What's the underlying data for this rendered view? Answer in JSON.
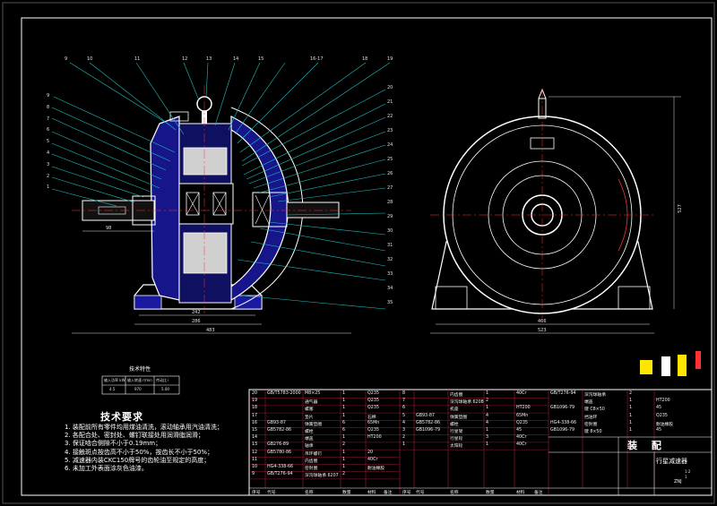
{
  "drawing": {
    "title_block": {
      "assembly_label": "装 配",
      "product_name": "行星减速器",
      "drawing_code": "ZNJ",
      "scale": "1:2",
      "sheet": "1"
    },
    "tech_requirements": {
      "title": "技术要求",
      "items": [
        "1. 装配前所有零件均用煤油清洗，滚动轴承用汽油清洗；",
        "2. 各配合处、密封处、螺钉联接处用润滑脂润滑；",
        "3. 保证啮合侧隙不小于0.19mm；",
        "4. 接触斑点按齿高不小于50%，按齿长不小于50%；",
        "5. 减速器内装CKC150牌号的齿轮油至规定的高度；",
        "6. 未加工外表面涂灰色油漆。"
      ]
    },
    "tech_table_title": "技术特性",
    "tech_table_rows": [
      [
        "输入功率 kW",
        "输入转速 r/min",
        "传动比 i"
      ],
      [
        "4.5",
        "970",
        "5.00"
      ]
    ],
    "balloon_numbers_left": [
      "9",
      "8",
      "7",
      "6",
      "5",
      "4",
      "3",
      "2",
      "1"
    ],
    "balloon_numbers_top": [
      "9",
      "10",
      "11",
      "12",
      "13",
      "14",
      "15",
      "16-17",
      "18",
      "19"
    ],
    "balloon_numbers_right": [
      "20",
      "21",
      "22",
      "23",
      "24",
      "25",
      "26",
      "27",
      "28",
      "29",
      "30",
      "31",
      "32",
      "33",
      "34",
      "35"
    ],
    "dimensions": {
      "left_bottom_a": "242",
      "left_bottom_b": "286",
      "left_bottom_c": "483",
      "left_shaft": "98",
      "right_bottom_a": "466",
      "right_bottom_b": "523",
      "right_height": "527"
    },
    "bom_left": [
      [
        "20",
        "GB/T5783-2000",
        "M8×25",
        "1",
        "Q235"
      ],
      [
        "19",
        "",
        "通气器",
        "1",
        "Q235"
      ],
      [
        "18",
        "",
        "螺塞",
        "1",
        "Q235"
      ],
      [
        "17",
        "",
        "垫片",
        "1",
        "石棉"
      ],
      [
        "16",
        "GB93-87",
        "弹簧垫圈",
        "6",
        "65Mn"
      ],
      [
        "15",
        "GB5782-86",
        "螺栓",
        "6",
        "Q235"
      ],
      [
        "14",
        "",
        "端盖",
        "1",
        "HT200"
      ],
      [
        "13",
        "GB276-89",
        "轴承",
        "2",
        ""
      ],
      [
        "12",
        "GB5780-86",
        "吊环螺钉",
        "1",
        "20"
      ],
      [
        "11",
        "",
        "内齿圈",
        "1",
        "40Cr"
      ],
      [
        "10",
        "HG4-338-66",
        "密封圈",
        "1",
        "耐油橡胶"
      ],
      [
        "9",
        "GB/T276-94",
        "深沟球轴承 6207",
        "2",
        ""
      ]
    ],
    "bom_mid": [
      [
        "8",
        "",
        "内齿圈",
        "1",
        "40Cr"
      ],
      [
        "7",
        "",
        "深沟球轴承 6208",
        "2",
        ""
      ],
      [
        "6",
        "",
        "机座",
        "1",
        "HT200"
      ],
      [
        "5",
        "GB93-87",
        "弹簧垫圈",
        "4",
        "65Mn"
      ],
      [
        "4",
        "GB5782-86",
        "螺栓",
        "4",
        "Q235"
      ],
      [
        "3",
        "GB1096-79",
        "行星架",
        "1",
        "45"
      ],
      [
        "2",
        "",
        "行星轮",
        "3",
        "40Cr"
      ],
      [
        "1",
        "",
        "太阳轮",
        "1",
        "40Cr"
      ]
    ],
    "bom_right": [
      [
        "GB/T276-94",
        "深沟球轴承",
        "2",
        ""
      ],
      [
        "",
        "端盖",
        "1",
        "HT200"
      ],
      [
        "GB1096-79",
        "键 C8×50",
        "1",
        "45"
      ],
      [
        "",
        "挡油环",
        "1",
        "Q235"
      ],
      [
        "HG4-338-66",
        "密封圈",
        "1",
        "耐油橡胶"
      ],
      [
        "GB1096-79",
        "键 8×50",
        "1",
        "45"
      ]
    ],
    "bom_header": [
      "序号",
      "代号",
      "名称",
      "数量",
      "材料",
      "备注"
    ],
    "colors": {
      "outline": "#ffffff",
      "body": "#1a1aa0",
      "leader": "#1fbfbf",
      "table_line": "#c81e3c",
      "dimension": "#e0e0e0",
      "gear_fill": "#d0d0d0",
      "accent_yellow": "#ffe600",
      "accent_red": "#ff3030"
    }
  }
}
